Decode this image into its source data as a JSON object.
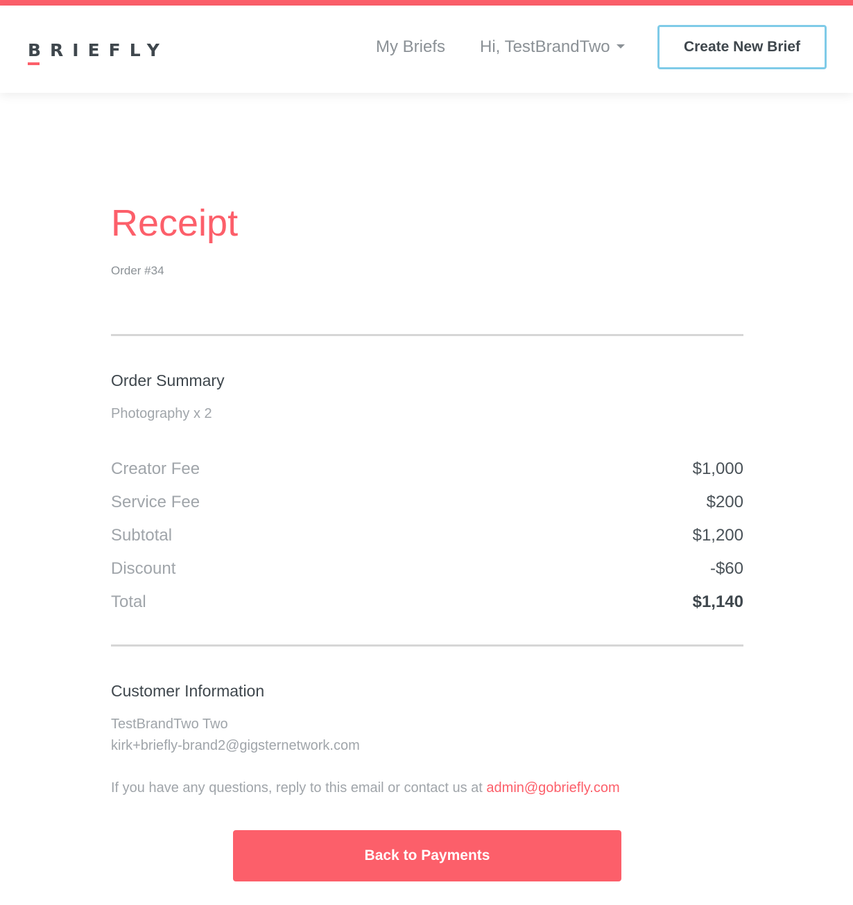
{
  "brand": {
    "logo_text": "BRIEFLY",
    "accent_color": "#fc5f6a",
    "button_border_color": "#7fcbe8"
  },
  "header": {
    "nav_my_briefs": "My Briefs",
    "nav_user": "Hi, TestBrandTwo",
    "user_menu_icon": "caret-down-icon",
    "create_button": "Create New Brief"
  },
  "receipt": {
    "title": "Receipt",
    "order_number": "Order #34"
  },
  "order_summary": {
    "heading": "Order Summary",
    "product": "Photography x 2",
    "line_items": [
      {
        "label": "Creator Fee",
        "value": "$1,000"
      },
      {
        "label": "Service Fee",
        "value": "$200"
      },
      {
        "label": "Subtotal",
        "value": "$1,200"
      },
      {
        "label": "Discount",
        "value": "-$60"
      },
      {
        "label": "Total",
        "value": "$1,140"
      }
    ]
  },
  "customer": {
    "heading": "Customer Information",
    "name": "TestBrandTwo Two",
    "email": "kirk+briefly-brand2@gigsternetwork.com"
  },
  "contact": {
    "text": "If you have any questions, reply to this email or contact us at ",
    "email": "admin@gobriefly.com"
  },
  "actions": {
    "back_button": "Back to Payments"
  }
}
